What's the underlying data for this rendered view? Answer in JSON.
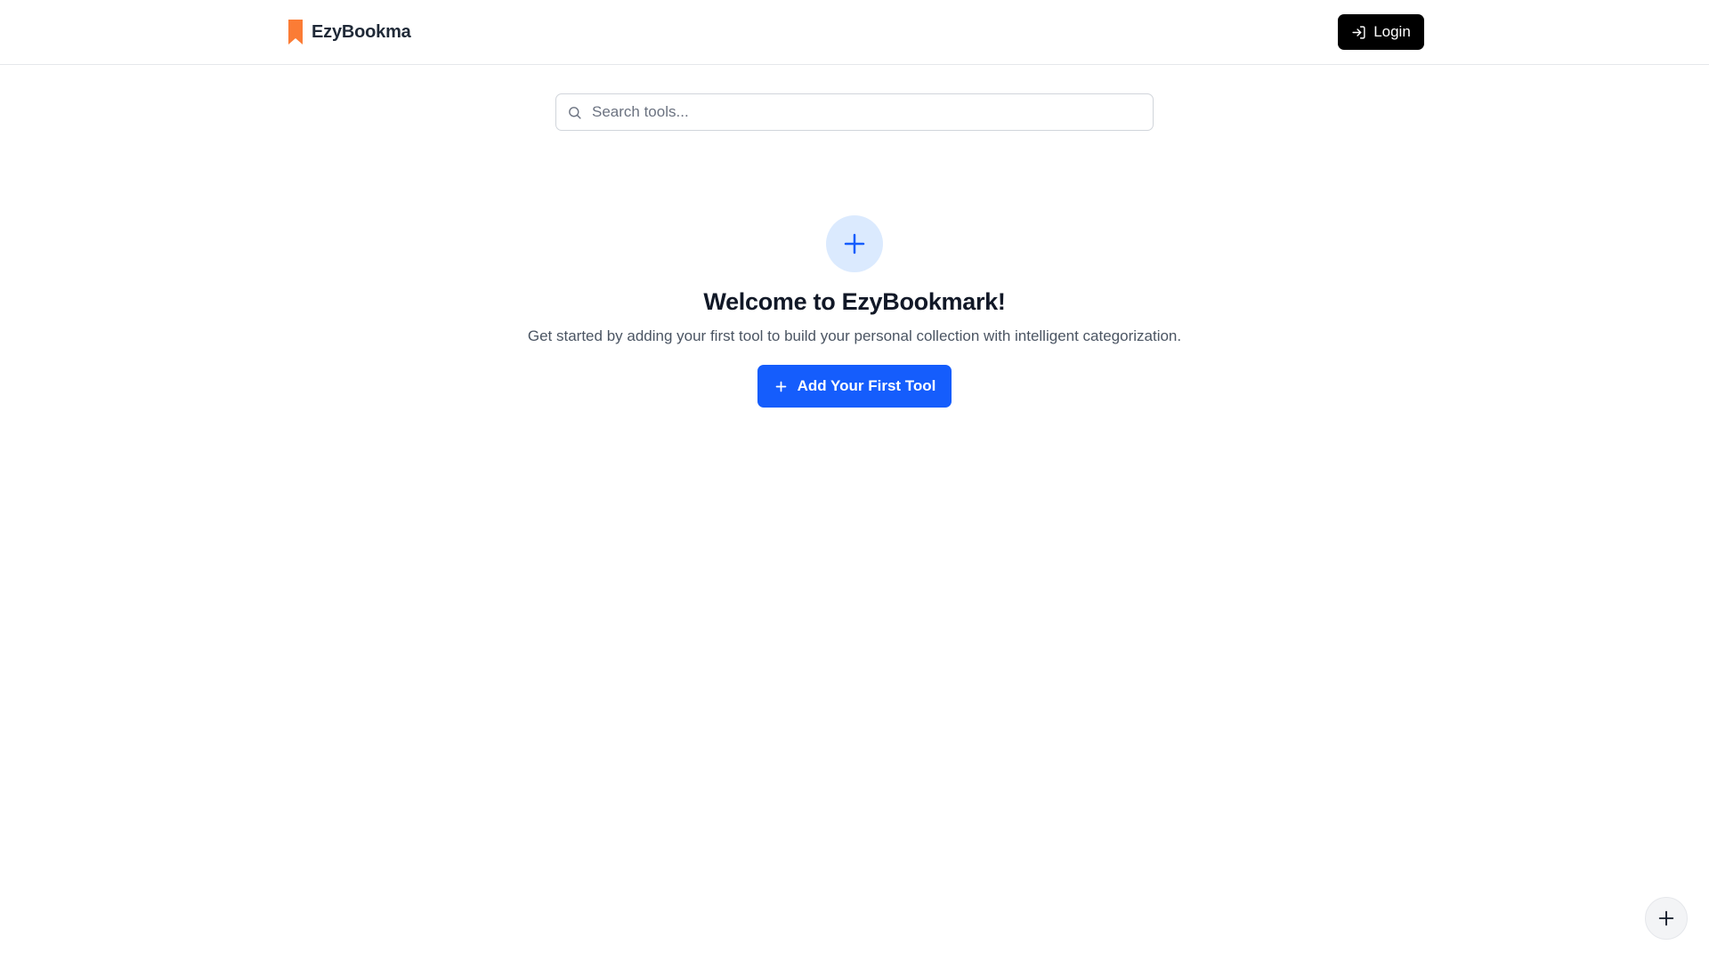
{
  "header": {
    "brand_name": "EzyBookmark",
    "brand_color": "#fb7c35",
    "brand_icon": "bookmark-icon",
    "login_label": "Login",
    "login_icon": "login-arrow-icon"
  },
  "search": {
    "placeholder": "Search tools...",
    "value": "",
    "icon": "search-icon"
  },
  "empty_state": {
    "icon": "plus-icon",
    "title": "Welcome to EzyBookmark!",
    "subtitle": "Get started by adding your first tool to build your personal collection with intelligent categorization.",
    "cta_label": "Add Your First Tool",
    "cta_color": "#155dfc"
  },
  "fab": {
    "icon": "plus-icon"
  }
}
